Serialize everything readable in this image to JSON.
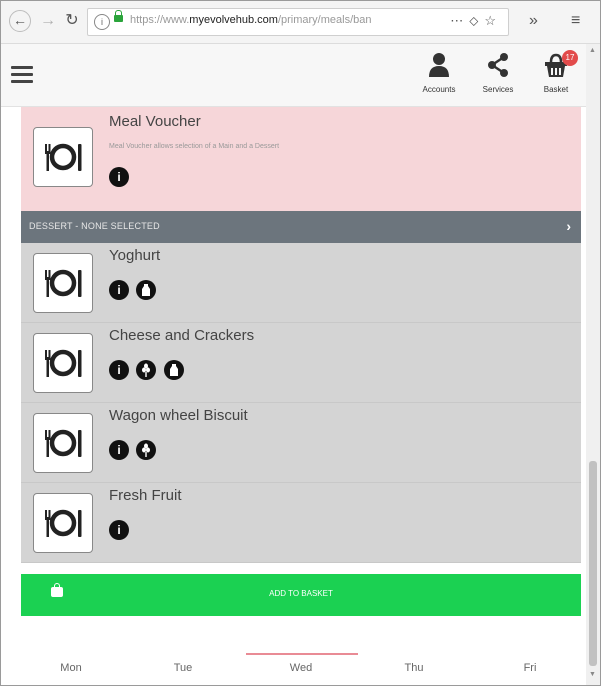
{
  "browser": {
    "url_prefix": "https://www.",
    "url_domain": "myevolvehub.com",
    "url_rest": "/primary/meals/ban",
    "more": "⋯",
    "back": "←",
    "forward": "→",
    "reload": "↻",
    "overflow": "»",
    "menu": "≡"
  },
  "header": {
    "accounts_label": "Accounts",
    "services_label": "Services",
    "basket_label": "Basket",
    "basket_count": "17"
  },
  "voucher": {
    "title": "Meal Voucher",
    "description": "Meal Voucher allows selection of a Main and a Dessert"
  },
  "section": {
    "label": "DESSERT - NONE SELECTED",
    "chevron": "›"
  },
  "items": [
    {
      "title": "Yoghurt",
      "icons": [
        "info-icon",
        "milk-icon"
      ]
    },
    {
      "title": "Cheese and Crackers",
      "icons": [
        "info-icon",
        "wheat-icon",
        "milk-icon"
      ]
    },
    {
      "title": "Wagon wheel Biscuit",
      "icons": [
        "info-icon",
        "wheat-icon"
      ]
    },
    {
      "title": "Fresh Fruit",
      "icons": [
        "info-icon"
      ]
    }
  ],
  "add_button": {
    "label": "ADD TO BASKET"
  },
  "days": [
    "Mon",
    "Tue",
    "Wed",
    "Thu",
    "Fri"
  ],
  "active_day": "Wed",
  "colors": {
    "voucher_bg": "#f6d6d9",
    "section_bar": "#6c757d",
    "item_bg": "#d4d4d4",
    "add_button": "#1bd152",
    "active_day_indicator": "#e98b95",
    "basket_badge": "#e24b4b"
  }
}
